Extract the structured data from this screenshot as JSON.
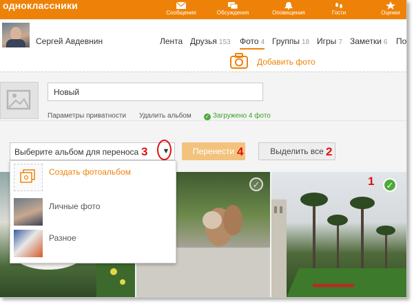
{
  "colors": {
    "accent": "#ee8208",
    "success": "#4caa3a",
    "annotation": "#e01010"
  },
  "header": {
    "logo": "одноклассники",
    "nav": [
      {
        "label": "Сообщения",
        "icon": "envelope-icon"
      },
      {
        "label": "Обсуждения",
        "icon": "chat-icon"
      },
      {
        "label": "Оповещения",
        "icon": "bell-icon"
      },
      {
        "label": "Гости",
        "icon": "footprints-icon"
      },
      {
        "label": "Оценки",
        "icon": "star-icon"
      }
    ]
  },
  "profile": {
    "name": "Сергей Авдевнин",
    "tabs": [
      {
        "label": "Лента",
        "count": ""
      },
      {
        "label": "Друзья",
        "count": "153"
      },
      {
        "label": "Фото",
        "count": "4",
        "active": true
      },
      {
        "label": "Группы",
        "count": "18"
      },
      {
        "label": "Игры",
        "count": "7"
      },
      {
        "label": "Заметки",
        "count": "6"
      },
      {
        "label": "По",
        "count": ""
      }
    ],
    "add_photo": "Добавить фото"
  },
  "album": {
    "name_value": "Новый",
    "privacy_link": "Параметры приватности",
    "delete_link": "Удалить альбом",
    "loaded_status": "Загружено 4 фото"
  },
  "actions": {
    "select_placeholder": "Выберите альбом для переноса",
    "move_button": "Перенести",
    "select_all_button": "Выделить все"
  },
  "dropdown": {
    "items": [
      {
        "label": "Создать фотоальбом",
        "icon": "create-album-icon"
      },
      {
        "label": "Личные фото"
      },
      {
        "label": "Разное"
      }
    ]
  },
  "annotations": {
    "m1": "1",
    "m2": "2",
    "m3": "3",
    "m4": "4"
  },
  "photos": [
    {
      "subject": "swan",
      "selected": false
    },
    {
      "subject": "squirrel",
      "selected": false
    },
    {
      "subject": "palm-trees",
      "selected": true
    }
  ]
}
